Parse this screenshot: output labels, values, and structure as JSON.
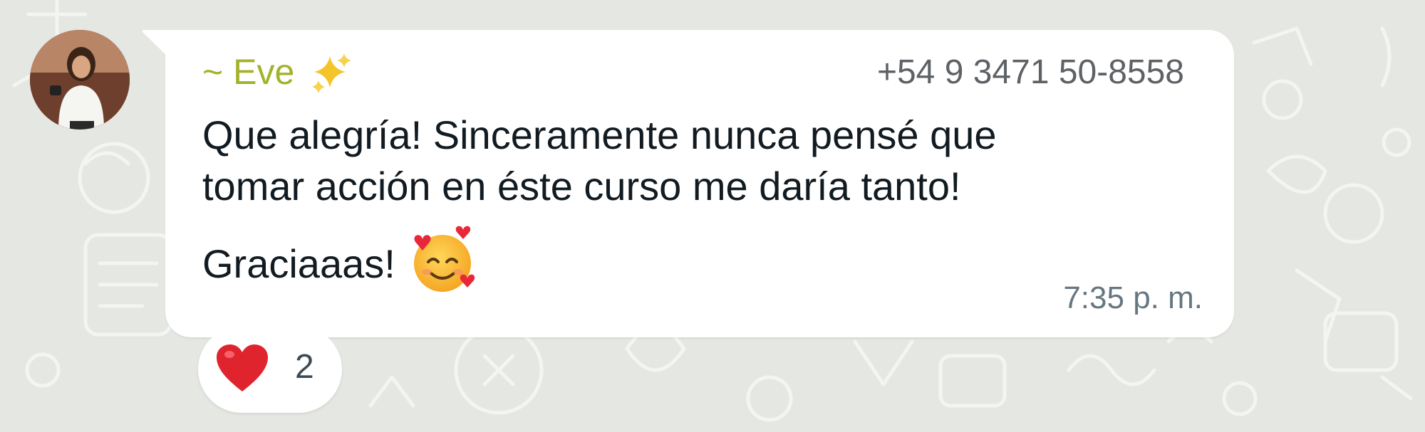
{
  "message": {
    "sender_name": "~ Eve",
    "sender_emoji": "sparkles",
    "sender_phone": "+54 9 3471 50-8558",
    "text_line_1": "Que alegría! Sinceramente nunca pensé que",
    "text_line_2": "tomar acción en éste curso me daría tanto!",
    "text_line_3": "Graciaaas!",
    "trailing_emoji": "smiling-face-with-hearts",
    "timestamp": "7:35 p. m."
  },
  "reaction": {
    "emoji": "red-heart",
    "count": "2"
  },
  "colors": {
    "sender_name": "#a3b22b",
    "background": "#e5e7e3",
    "bubble": "#ffffff",
    "heart": "#e0242e"
  }
}
